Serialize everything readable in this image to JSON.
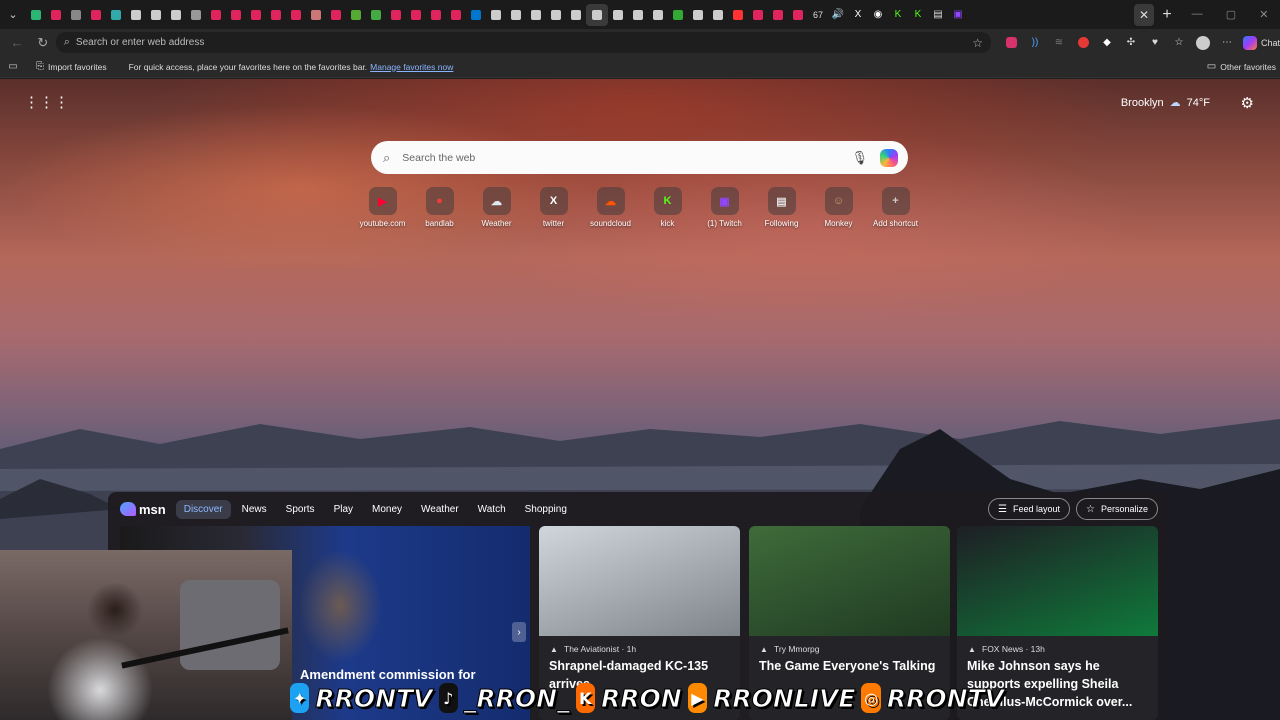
{
  "browser": {
    "tab_count_badge": "67",
    "address_placeholder": "Search or enter web address",
    "chat_label": "Chat",
    "favorites_bar": {
      "import_label": "Import favorites",
      "message": "For quick access, place your favorites here on the favorites bar.",
      "manage_link": "Manage favorites now",
      "other_favorites": "Other favorites"
    }
  },
  "newtab": {
    "weather": {
      "location": "Brooklyn",
      "temperature": "74°F"
    },
    "search_placeholder": "Search the web",
    "shortcuts": [
      {
        "label": "youtube.com",
        "glyph": "▶",
        "color": "#ff0033"
      },
      {
        "label": "bandlab",
        "glyph": "●",
        "color": "#f43b3b"
      },
      {
        "label": "Weather",
        "glyph": "☁",
        "color": "#dfe7ef"
      },
      {
        "label": "twitter",
        "glyph": "X",
        "color": "#ffffff"
      },
      {
        "label": "soundcloud",
        "glyph": "☁",
        "color": "#ff5500"
      },
      {
        "label": "kick",
        "glyph": "K",
        "color": "#53fc18"
      },
      {
        "label": "(1) Twitch",
        "glyph": "▣",
        "color": "#9146ff"
      },
      {
        "label": "Following",
        "glyph": "▤",
        "color": "#e0e0e0"
      },
      {
        "label": "Monkey",
        "glyph": "☺",
        "color": "#c9a070"
      },
      {
        "label": "Add shortcut",
        "glyph": "+",
        "color": "#cccccc"
      }
    ]
  },
  "msn": {
    "logo": "msn",
    "tabs": [
      "Discover",
      "News",
      "Sports",
      "Play",
      "Money",
      "Weather",
      "Watch",
      "Shopping"
    ],
    "feed_layout_label": "Feed layout",
    "personalize_label": "Personalize",
    "hero_headline": "Amendment commission for",
    "cards": [
      {
        "source": "The Aviationist · 1h",
        "title": "Shrapnel-damaged KC-135 arrives",
        "image_colors": [
          "#cfd6dc",
          "#7d848a"
        ]
      },
      {
        "source": "Try Mmorpg",
        "title": "The Game Everyone's Talking",
        "image_colors": [
          "#3f6b3a",
          "#1f3a22"
        ]
      },
      {
        "source": "FOX News · 13h",
        "title": "Mike Johnson says he supports expelling Sheila Cherfilus-McCormick over...",
        "image_colors": [
          "#1e1e24",
          "#0f7a3b"
        ]
      }
    ]
  },
  "overlay": {
    "banner": [
      "RRONTV",
      "_RRON_",
      "RRON",
      "RRONLIVE",
      "RRONTV"
    ]
  }
}
